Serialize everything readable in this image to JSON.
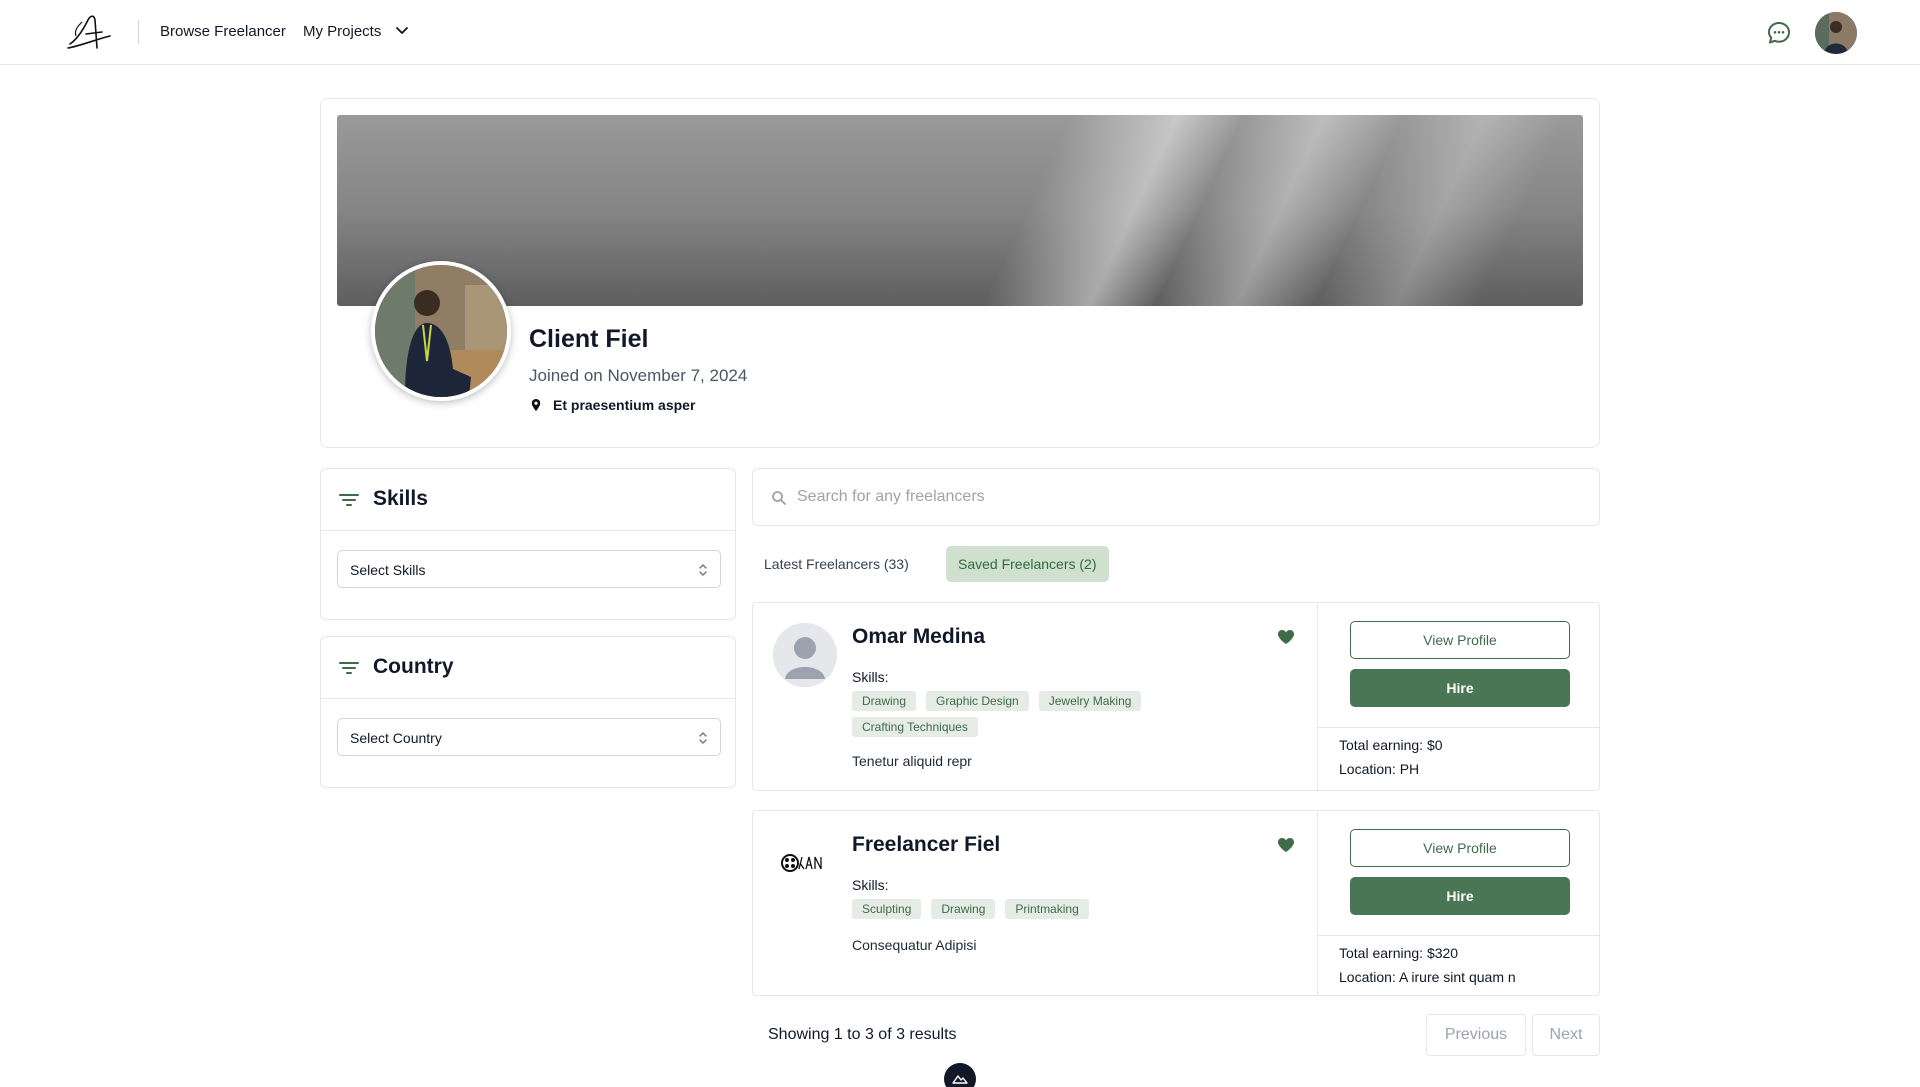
{
  "nav": {
    "browse_label": "Browse Freelancer",
    "projects_label": "My Projects"
  },
  "profile": {
    "name": "Client Fiel",
    "joined": "Joined on November 7, 2024",
    "location": "Et praesentium asper"
  },
  "filters": {
    "skills": {
      "title": "Skills",
      "select": "Select Skills"
    },
    "country": {
      "title": "Country",
      "select": "Select Country"
    }
  },
  "search": {
    "placeholder": "Search for any freelancers"
  },
  "tabs": [
    {
      "label": "Latest Freelancers (33)",
      "active": false
    },
    {
      "label": "Saved Freelancers (2)",
      "active": true
    }
  ],
  "freelancers": [
    {
      "name": "Omar Medina",
      "skills_label": "Skills:",
      "skills": [
        "Drawing",
        "Graphic Design",
        "Jewelry Making",
        "Crafting Techniques"
      ],
      "description": "Tenetur aliquid repr",
      "view_label": "View Profile",
      "hire_label": "Hire",
      "earning": "Total earning: $0",
      "location": "Location: PH"
    },
    {
      "name": "Freelancer Fiel",
      "skills_label": "Skills:",
      "skills": [
        "Sculpting",
        "Drawing",
        "Printmaking"
      ],
      "description": "Consequatur Adipisi",
      "view_label": "View Profile",
      "hire_label": "Hire",
      "earning": "Total earning: $320",
      "location": "Location: A irure sint quam n"
    }
  ],
  "pagination": {
    "summary": "Showing 1 to 3 of 3 results",
    "previous": "Previous",
    "next": "Next"
  },
  "colors": {
    "accent": "#4a7656",
    "accent_light": "#cfe0cf",
    "chip_bg": "#e5ece5"
  }
}
